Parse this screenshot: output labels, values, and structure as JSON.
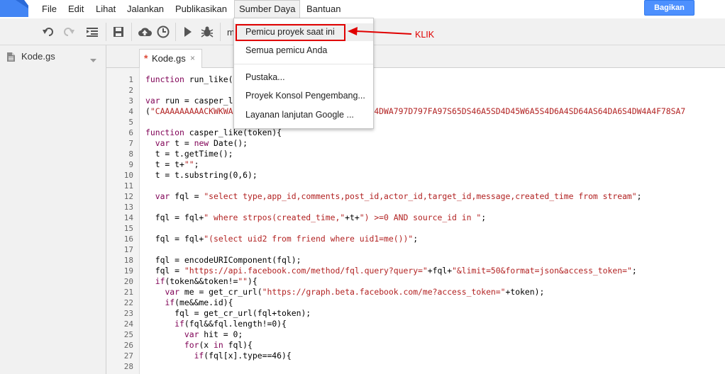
{
  "menubar": {
    "items": [
      "File",
      "Edit",
      "Lihat",
      "Jalankan",
      "Publikasikan",
      "Sumber Daya",
      "Bantuan"
    ],
    "open_item": "Sumber Daya",
    "share_label": "Bagikan"
  },
  "toolbar": {
    "buttons": [
      "undo-icon",
      "redo-icon",
      "indent-icon",
      "save-icon",
      "cloud-upload-icon",
      "clock-icon",
      "run-icon",
      "debug-icon",
      "function-select"
    ],
    "function_select_partial": "m"
  },
  "sidebar": {
    "file_name": "Kode.gs"
  },
  "editor": {
    "tab_label": "Kode.gs",
    "tab_modified_marker": "*",
    "tab_close": "×",
    "lines": [
      {
        "n": "1",
        "text": "function run_like("
      },
      {
        "n": "2",
        "text": ""
      },
      {
        "n": "3",
        "text": "var run = casper_l"
      },
      {
        "n": "4",
        "text": "(\"CAAAAAAAAACKWKWA                        4A6S54DWA797D797FA97S65DS46A5SD4D45W6A5S4D6A4SD64AS64DA6S4DW4A4F78SA7"
      },
      {
        "n": "5",
        "text": ""
      },
      {
        "n": "6",
        "text": "function casper_like(token){"
      },
      {
        "n": "7",
        "text": "  var t = new Date();"
      },
      {
        "n": "8",
        "text": "  t = t.getTime();"
      },
      {
        "n": "9",
        "text": "  t = t+\"\";"
      },
      {
        "n": "10",
        "text": "  t = t.substring(0,6);"
      },
      {
        "n": "11",
        "text": ""
      },
      {
        "n": "12",
        "text": "  var fql = \"select type,app_id,comments,post_id,actor_id,target_id,message,created_time from stream\";"
      },
      {
        "n": "13",
        "text": ""
      },
      {
        "n": "14",
        "text": "  fql = fql+\" where strpos(created_time,\"+t+\") >=0 AND source_id in \";"
      },
      {
        "n": "15",
        "text": ""
      },
      {
        "n": "16",
        "text": "  fql = fql+\"(select uid2 from friend where uid1=me())\";"
      },
      {
        "n": "17",
        "text": ""
      },
      {
        "n": "18",
        "text": "  fql = encodeURIComponent(fql);"
      },
      {
        "n": "19",
        "text": "  fql = \"https://api.facebook.com/method/fql.query?query=\"+fql+\"&limit=50&format=json&access_token=\";"
      },
      {
        "n": "20",
        "text": "  if(token&&token!=\"\"){"
      },
      {
        "n": "21",
        "text": "    var me = get_cr_url(\"https://graph.beta.facebook.com/me?access_token=\"+token);"
      },
      {
        "n": "22",
        "text": "    if(me&&me.id){"
      },
      {
        "n": "23",
        "text": "      fql = get_cr_url(fql+token);"
      },
      {
        "n": "24",
        "text": "      if(fql&&fql.length!=0){"
      },
      {
        "n": "25",
        "text": "        var hit = 0;"
      },
      {
        "n": "26",
        "text": "        for(x in fql){"
      },
      {
        "n": "27",
        "text": "          if(fql[x].type==46){"
      },
      {
        "n": "28",
        "text": ""
      }
    ]
  },
  "dropdown": {
    "items": [
      {
        "label": "Pemicu proyek saat ini",
        "highlighted": true
      },
      {
        "label": "Semua pemicu Anda",
        "highlighted": false
      },
      {
        "label": "Pustaka...",
        "highlighted": false
      },
      {
        "label": "Proyek Konsol Pengembang...",
        "highlighted": false
      },
      {
        "label": "Layanan lanjutan Google ...",
        "highlighted": false
      }
    ]
  },
  "annotation": {
    "label": "KLIK",
    "color": "#e00000"
  },
  "colors": {
    "accent": "#4d90fe",
    "keyword": "#7f0055",
    "string": "#b22222",
    "variable": "#1a3cb0"
  }
}
